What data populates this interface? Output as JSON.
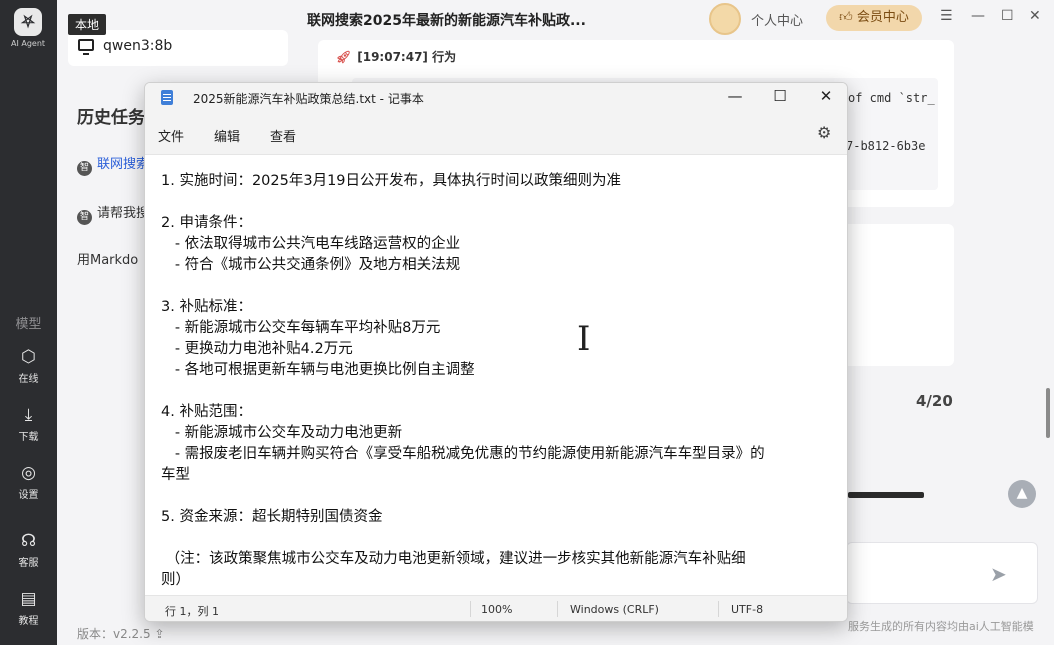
{
  "app": {
    "logo_caption": "AI Agent",
    "version": "版本：v2.2.5"
  },
  "rail": {
    "section_label": "模型",
    "items": [
      {
        "label": "在线",
        "icon": "cube-icon"
      },
      {
        "label": "下载",
        "icon": "download-icon"
      },
      {
        "label": "设置",
        "icon": "settings-icon"
      },
      {
        "label": "客服",
        "icon": "headset-icon"
      },
      {
        "label": "教程",
        "icon": "book-icon"
      }
    ]
  },
  "panel": {
    "local_badge": "本地",
    "model_name": "qwen3:8b",
    "history_title": "历史任务",
    "history": [
      {
        "text": "联网搜索",
        "icon_text": "智"
      },
      {
        "text": "请帮我搜",
        "icon_text": "智"
      },
      {
        "text": "用Markdo",
        "icon_text": ""
      }
    ]
  },
  "header": {
    "title": "联网搜索2025年最新的新能源汽车补贴政...",
    "user_center": "个人中心",
    "vip_label": "会员中心"
  },
  "chat": {
    "time_line": "[19:07:47] 行为",
    "code_frag_1": "of cmd `str_",
    "code_frag_2": "7-b812-6b3e",
    "page_indicator": "4/20",
    "disclaimer": "服务生成的所有内容均由ai人工智能模型生成，请仔细甄别"
  },
  "notepad": {
    "title": "2025新能源汽车补贴政策总结.txt - 记事本",
    "menus": [
      "文件",
      "编辑",
      "查看"
    ],
    "lines": [
      "1. 实施时间：2025年3月19日公开发布，具体执行时间以政策细则为准",
      "",
      "2. 申请条件：",
      "   - 依法取得城市公共汽电车线路运营权的企业",
      "   - 符合《城市公共交通条例》及地方相关法规",
      "",
      "3. 补贴标准：",
      "   - 新能源城市公交车每辆车平均补贴8万元",
      "   - 更换动力电池补贴4.2万元",
      "   - 各地可根据更新车辆与电池更换比例自主调整",
      "",
      "4. 补贴范围：",
      "   - 新能源城市公交车及动力电池更新",
      "   - 需报废老旧车辆并购买符合《享受车船税减免优惠的节约能源使用新能源汽车车型目录》的",
      "车型",
      "",
      "5. 资金来源：超长期特别国债资金",
      "",
      " （注：该政策聚焦城市公交车及动力电池更新领域，建议进一步核实其他新能源汽车补贴细",
      "则）"
    ],
    "status": {
      "position": "行 1，列 1",
      "zoom": "100%",
      "line_ending": "Windows (CRLF)",
      "encoding": "UTF-8"
    }
  }
}
